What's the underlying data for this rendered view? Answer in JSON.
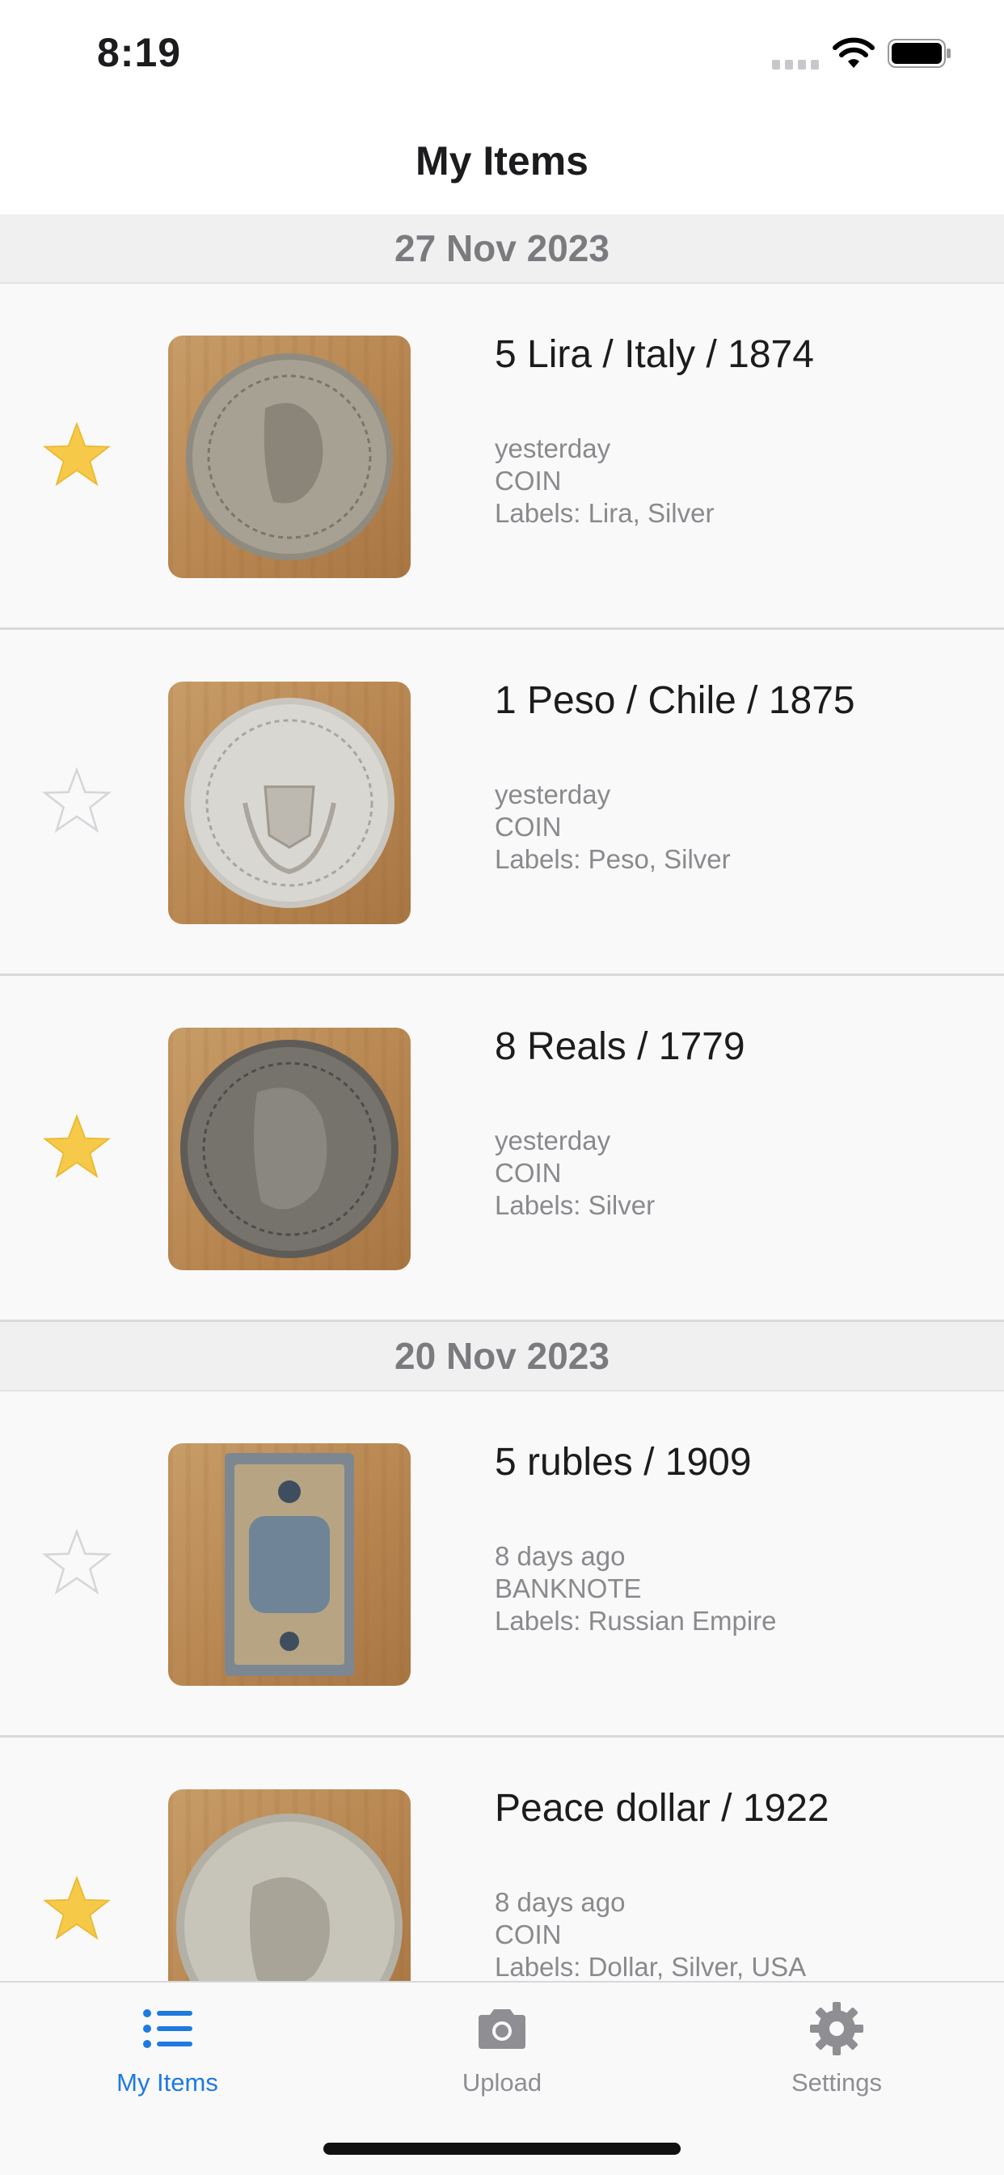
{
  "status_bar": {
    "time": "8:19"
  },
  "nav": {
    "title": "My Items"
  },
  "sections": [
    {
      "date": "27 Nov 2023",
      "items": [
        {
          "title": "5 Lira / Italy / 1874",
          "when": "yesterday",
          "type": "COIN",
          "labels": "Labels: Lira, Silver",
          "favorite": true
        },
        {
          "title": "1 Peso / Chile / 1875",
          "when": "yesterday",
          "type": "COIN",
          "labels": "Labels: Peso, Silver",
          "favorite": false
        },
        {
          "title": "8 Reals / 1779",
          "when": "yesterday",
          "type": "COIN",
          "labels": "Labels: Silver",
          "favorite": true
        }
      ]
    },
    {
      "date": "20 Nov 2023",
      "items": [
        {
          "title": "5 rubles / 1909",
          "when": "8 days ago",
          "type": "BANKNOTE",
          "labels": "Labels: Russian Empire",
          "favorite": false
        },
        {
          "title": "Peace dollar / 1922",
          "when": "8 days ago",
          "type": "COIN",
          "labels": "Labels: Dollar, Silver, USA",
          "favorite": true
        }
      ]
    }
  ],
  "tabs": [
    {
      "label": "My Items",
      "icon": "list-icon",
      "active": true
    },
    {
      "label": "Upload",
      "icon": "camera-icon",
      "active": false
    },
    {
      "label": "Settings",
      "icon": "gear-icon",
      "active": false
    }
  ],
  "colors": {
    "accent": "#1f7ae0",
    "favorite_star": "#f7c948",
    "inactive": "#8e8e93"
  }
}
